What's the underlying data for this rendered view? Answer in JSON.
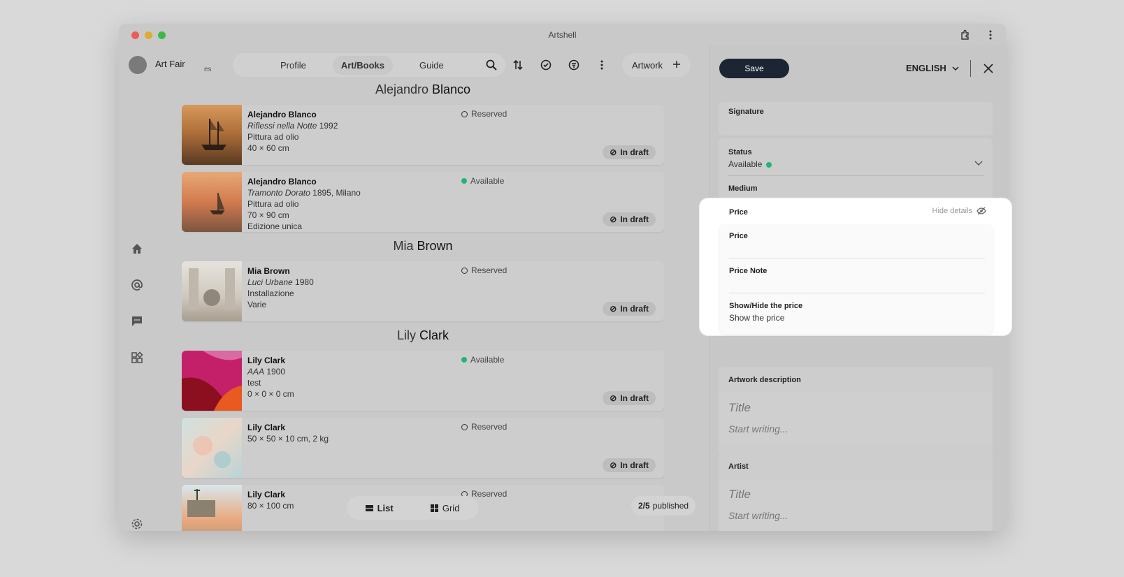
{
  "window": {
    "title": "Artshell"
  },
  "colors": {
    "accent_dark": "#1c2533",
    "available": "#22b573"
  },
  "header": {
    "org_name": "Art Fair",
    "org_sub": "es",
    "tabs": [
      {
        "label": "Profile"
      },
      {
        "label": "Art/Books"
      },
      {
        "label": "Guide"
      }
    ],
    "artwork_button": "Artwork"
  },
  "groups": [
    {
      "first": "Alejandro",
      "last": "Blanco",
      "items": [
        {
          "name": "Alejandro Blanco",
          "title": "Riflessi nella Notte",
          "year": " 1992",
          "lines": [
            "Pittura ad olio",
            "40 × 60 cm"
          ],
          "status": "Reserved",
          "draft": "In draft"
        },
        {
          "name": "Alejandro Blanco",
          "title": "Tramonto Dorato",
          "year": " 1895, Milano",
          "lines": [
            "Pittura ad olio",
            "70 × 90 cm",
            "Edizione unica"
          ],
          "status": "Available",
          "draft": "In draft"
        }
      ]
    },
    {
      "first": "Mia",
      "last": "Brown",
      "items": [
        {
          "name": "Mia Brown",
          "title": "Luci Urbane",
          "year": " 1980",
          "lines": [
            "Installazione",
            "Varie"
          ],
          "status": "Reserved",
          "draft": "In draft"
        }
      ]
    },
    {
      "first": "Lily",
      "last": "Clark",
      "items": [
        {
          "name": "Lily Clark",
          "title": "AAA",
          "year": " 1900",
          "lines": [
            "test",
            "0 × 0 × 0 cm"
          ],
          "status": "Available",
          "draft": "In draft"
        },
        {
          "name": "Lily Clark",
          "title": "",
          "year": "",
          "lines": [
            "50 × 50 × 10 cm, 2 kg"
          ],
          "status": "Reserved",
          "draft": "In draft"
        },
        {
          "name": "Lily Clark",
          "title": "",
          "year": "",
          "lines": [
            "80 × 100 cm"
          ],
          "status": "Reserved",
          "draft": ""
        }
      ]
    }
  ],
  "view_toggle": {
    "list": "List",
    "grid": "Grid"
  },
  "published": {
    "count": "2/5",
    "label": "published"
  },
  "panel": {
    "save": "Save",
    "language": "ENGLISH",
    "signature_label": "Signature",
    "status_label": "Status",
    "status_value": "Available",
    "medium_label": "Medium",
    "price_section": "Price",
    "hide_details": "Hide details",
    "price_label": "Price",
    "price_note_label": "Price Note",
    "show_hide_label": "Show/Hide the price",
    "show_hide_value": "Show the price",
    "description_label": "Artwork description",
    "artist_label": "Artist",
    "title_placeholder": "Title",
    "body_placeholder": "Start writing..."
  }
}
